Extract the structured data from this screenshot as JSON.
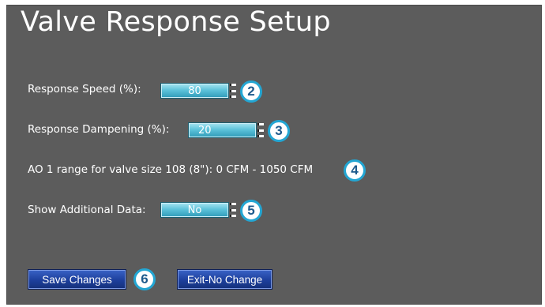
{
  "page": {
    "title": "Valve Response Setup"
  },
  "response_speed": {
    "label": "Response Speed (%):",
    "value": "80",
    "callout": "2"
  },
  "response_dampening": {
    "label": "Response Dampening (%):",
    "value": "20",
    "callout": "3"
  },
  "ao_range": {
    "text": "AO 1 range for valve size 108 (8\"):  0 CFM -  1050 CFM",
    "callout": "4"
  },
  "additional_data": {
    "label": "Show Additional Data:",
    "value": "No",
    "callout": "5"
  },
  "actions": {
    "save_label": "Save Changes",
    "exit_label": "Exit-No Change",
    "callout": "6"
  },
  "colors": {
    "panel": "#5c5c5c",
    "field": "#5ec3da",
    "button": "#1d3f9c",
    "badge_ring": "#23a6d3"
  }
}
